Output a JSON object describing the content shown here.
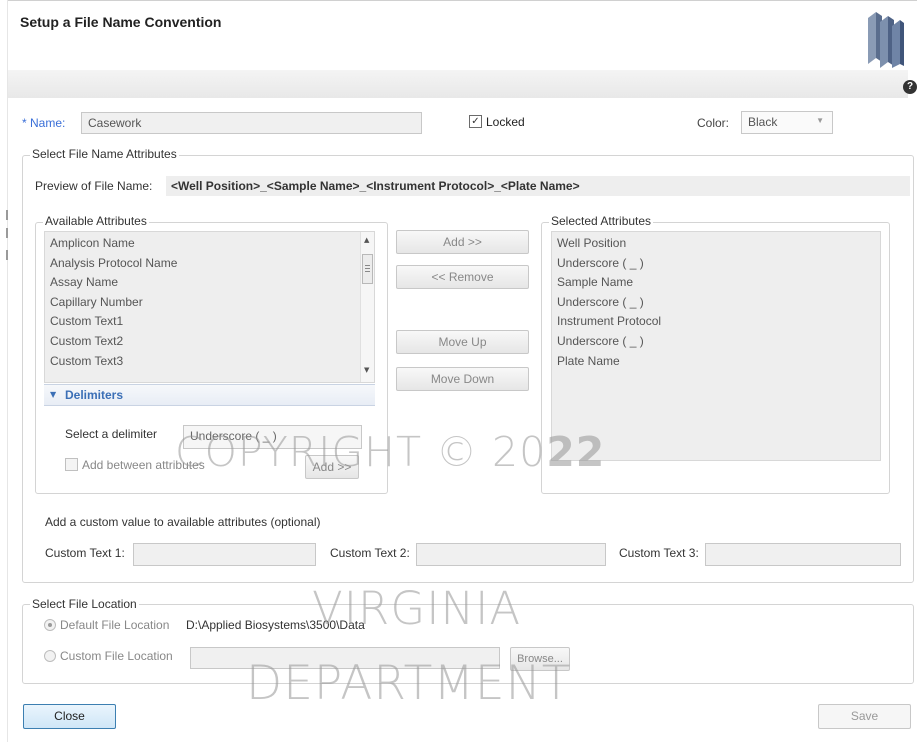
{
  "dialog": {
    "title": "Setup a File Name Convention",
    "help_label": "?"
  },
  "name_row": {
    "name_label": "Name:",
    "required_marker": "*",
    "name_value": "Casework",
    "locked_label": "Locked",
    "locked_checked": true,
    "color_label": "Color:",
    "color_value": "Black"
  },
  "attributes_section": {
    "title": "Select File Name Attributes",
    "preview_label": "Preview of File Name:",
    "preview_value": "<Well Position>_<Sample Name>_<Instrument Protocol>_<Plate Name>",
    "available_title": "Available Attributes",
    "available_items": [
      "Amplicon Name",
      "Analysis Protocol Name",
      "Assay Name",
      "Capillary Number",
      "Custom Text1",
      "Custom Text2",
      "Custom Text3"
    ],
    "selected_title": "Selected Attributes",
    "selected_items": [
      "Well Position",
      "Underscore ( _ )",
      "Sample Name",
      "Underscore ( _ )",
      "Instrument Protocol",
      "Underscore ( _ )",
      "Plate Name"
    ],
    "buttons": {
      "add": "Add >>",
      "remove": "<< Remove",
      "move_up": "Move Up",
      "move_down": "Move Down"
    },
    "delimiters": {
      "title": "Delimiters",
      "select_label": "Select a delimiter",
      "select_value": "Underscore ( _ )",
      "add_between_label": "Add between attributes",
      "add_button": "Add >>"
    },
    "custom_values": {
      "title": "Add a custom value to available attributes (optional)",
      "custom1_label": "Custom Text 1:",
      "custom2_label": "Custom Text 2:",
      "custom3_label": "Custom Text 3:"
    }
  },
  "location_section": {
    "title": "Select File Location",
    "default_label": "Default File Location",
    "default_path": "D:\\Applied Biosystems\\3500\\Data",
    "custom_label": "Custom File Location",
    "browse_button": "Browse..."
  },
  "footer": {
    "close_button": "Close",
    "save_button": "Save"
  },
  "watermark": {
    "line1_prefix": "COPYRIGHT © 20",
    "line1_bold": "22",
    "line2": "VIRGINIA",
    "line3": "DEPARTMENT"
  },
  "colors": {
    "required_marker": "#3a6fd8",
    "selection_blue": "#3b6fb6",
    "field_bg": "#f0f0f0",
    "list_bg": "#eeeeee"
  }
}
